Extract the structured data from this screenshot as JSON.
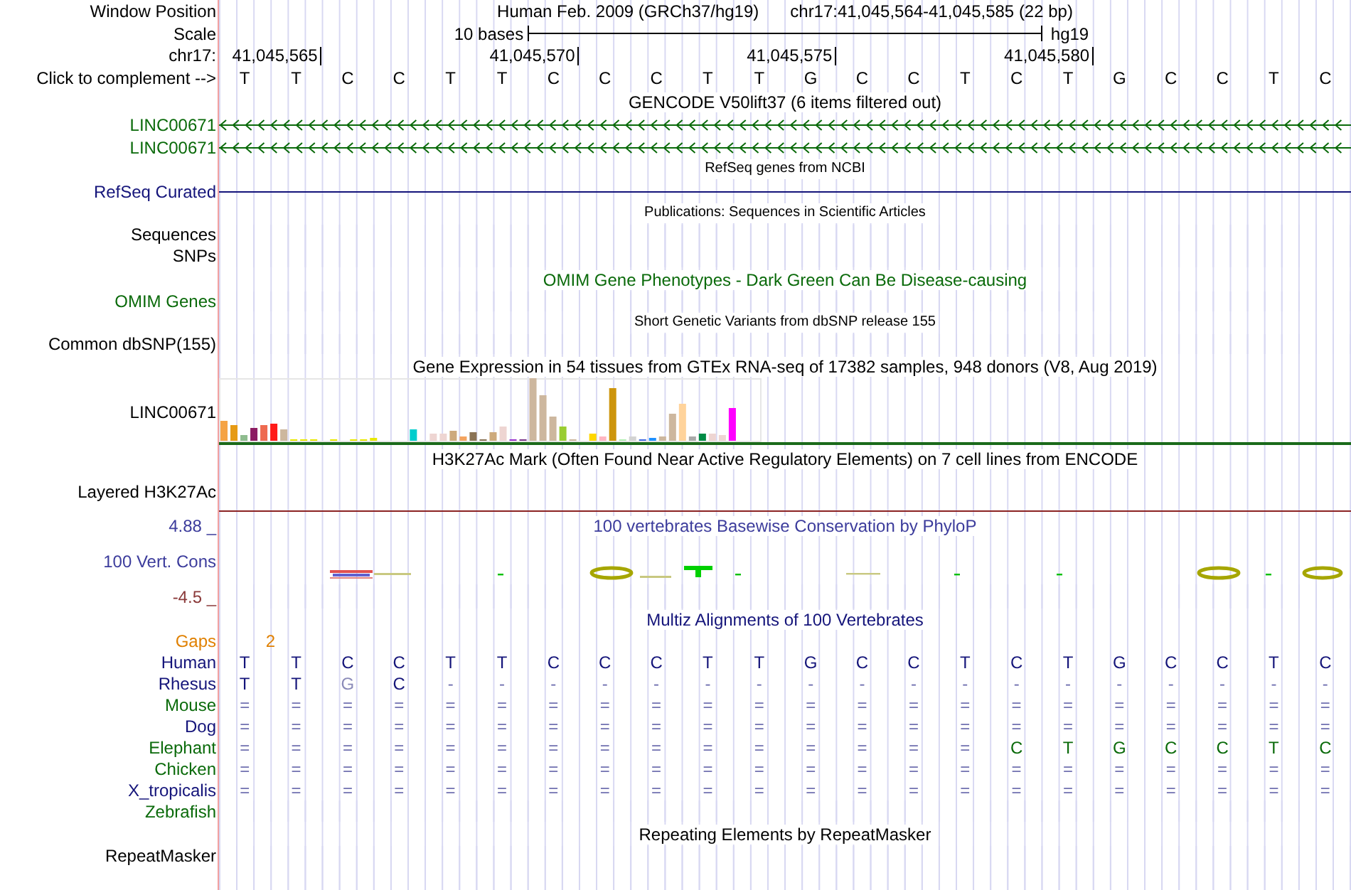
{
  "position": {
    "label": "Window Position",
    "assembly": "Human Feb. 2009 (GRCh37/hg19)",
    "range": "chr17:41,045,564-41,045,585 (22 bp)"
  },
  "scale": {
    "label": "Scale",
    "span": "10 bases",
    "assembly": "hg19"
  },
  "ruler": {
    "label": "chr17:",
    "ticks": [
      "41,045,565",
      "41,045,570",
      "41,045,575",
      "41,045,580"
    ]
  },
  "sequence": {
    "label": "Click to complement -->",
    "bases": [
      "T",
      "T",
      "C",
      "C",
      "T",
      "T",
      "C",
      "C",
      "C",
      "T",
      "T",
      "G",
      "C",
      "C",
      "T",
      "C",
      "T",
      "G",
      "C",
      "C",
      "T",
      "C"
    ]
  },
  "tracks": [
    {
      "kind": "genes",
      "title": "GENCODE V50lift37 (6 items filtered out)",
      "small_title": false,
      "color": "#0a6a0a",
      "genes": [
        {
          "name": "LINC00671",
          "kind": "reverse"
        },
        {
          "name": "LINC00671",
          "kind": "reverse"
        }
      ]
    },
    {
      "kind": "genes",
      "title": "RefSeq genes from NCBI",
      "small_title": true,
      "color": "#14147a",
      "genes": [
        {
          "name": "RefSeq Curated",
          "kind": "plain"
        }
      ]
    },
    {
      "kind": "labels",
      "title": "Publications: Sequences in Scientific Articles",
      "small_title": true,
      "labels": [
        "Sequences",
        "SNPs"
      ]
    },
    {
      "kind": "labels",
      "title": "OMIM Gene Phenotypes - Dark Green Can Be Disease-causing",
      "small_title": false,
      "color": "#0a6a0a",
      "labels": [
        "OMIM Genes"
      ]
    },
    {
      "kind": "labels",
      "title": "Short Genetic Variants from dbSNP release 155",
      "small_title": true,
      "labels": [
        "Common dbSNP(155)"
      ]
    },
    {
      "kind": "expression",
      "title": "Gene Expression in 54 tissues from GTEx RNA-seq of 17382 samples, 948 donors (V8, Aug 2019)",
      "small_title": false,
      "label": "LINC00671"
    },
    {
      "kind": "signal",
      "title": "H3K27Ac Mark (Often Found Near Active Regulatory Elements) on 7 cell lines from ENCODE",
      "small_title": false,
      "label": "Layered H3K27Ac"
    },
    {
      "kind": "conservation",
      "title": "100 vertebrates Basewise Conservation by PhyloP",
      "small_title": false,
      "color": "#3c3c9c",
      "label": "100 Vert. Cons",
      "max": "4.88 _",
      "min": "-4.5 _"
    },
    {
      "kind": "alignment",
      "title": "Multiz Alignments of 100 Vertebrates",
      "small_title": false,
      "color": "#14147a",
      "gaps": {
        "label": "Gaps",
        "value": "2"
      },
      "species": [
        {
          "name": "Human",
          "color": "#14147a",
          "bases": [
            "T",
            "T",
            "C",
            "C",
            "T",
            "T",
            "C",
            "C",
            "C",
            "T",
            "T",
            "G",
            "C",
            "C",
            "T",
            "C",
            "T",
            "G",
            "C",
            "C",
            "T",
            "C"
          ]
        },
        {
          "name": "Rhesus",
          "color": "#14147a",
          "bases": [
            "T",
            "T",
            "G",
            "C",
            "-",
            "-",
            "-",
            "-",
            "-",
            "-",
            "-",
            "-",
            "-",
            "-",
            "-",
            "-",
            "-",
            "-",
            "-",
            "-",
            "-",
            "-"
          ]
        },
        {
          "name": "Mouse",
          "color": "#0a6a0a",
          "bases": [
            "=",
            "=",
            "=",
            "=",
            "=",
            "=",
            "=",
            "=",
            "=",
            "=",
            "=",
            "=",
            "=",
            "=",
            "=",
            "=",
            "=",
            "=",
            "=",
            "=",
            "=",
            "="
          ]
        },
        {
          "name": "Dog",
          "color": "#14147a",
          "bases": [
            "=",
            "=",
            "=",
            "=",
            "=",
            "=",
            "=",
            "=",
            "=",
            "=",
            "=",
            "=",
            "=",
            "=",
            "=",
            "=",
            "=",
            "=",
            "=",
            "=",
            "=",
            "="
          ]
        },
        {
          "name": "Elephant",
          "color": "#0a6a0a",
          "bases": [
            "=",
            "=",
            "=",
            "=",
            "=",
            "=",
            "=",
            "=",
            "=",
            "=",
            "=",
            "=",
            "=",
            "=",
            "=",
            "C",
            "T",
            "G",
            "C",
            "C",
            "T",
            "C"
          ]
        },
        {
          "name": "Chicken",
          "color": "#0a6a0a",
          "bases": [
            "=",
            "=",
            "=",
            "=",
            "=",
            "=",
            "=",
            "=",
            "=",
            "=",
            "=",
            "=",
            "=",
            "=",
            "=",
            "=",
            "=",
            "=",
            "=",
            "=",
            "=",
            "="
          ]
        },
        {
          "name": "X_tropicalis",
          "color": "#14147a",
          "bases": [
            "=",
            "=",
            "=",
            "=",
            "=",
            "=",
            "=",
            "=",
            "=",
            "=",
            "=",
            "=",
            "=",
            "=",
            "=",
            "=",
            "=",
            "=",
            "=",
            "=",
            "=",
            "="
          ]
        },
        {
          "name": "Zebrafish",
          "color": "#0a6a0a"
        }
      ]
    },
    {
      "kind": "labels",
      "title": "Repeating Elements by RepeatMasker",
      "small_title": false,
      "labels": [
        "RepeatMasker"
      ]
    }
  ]
}
